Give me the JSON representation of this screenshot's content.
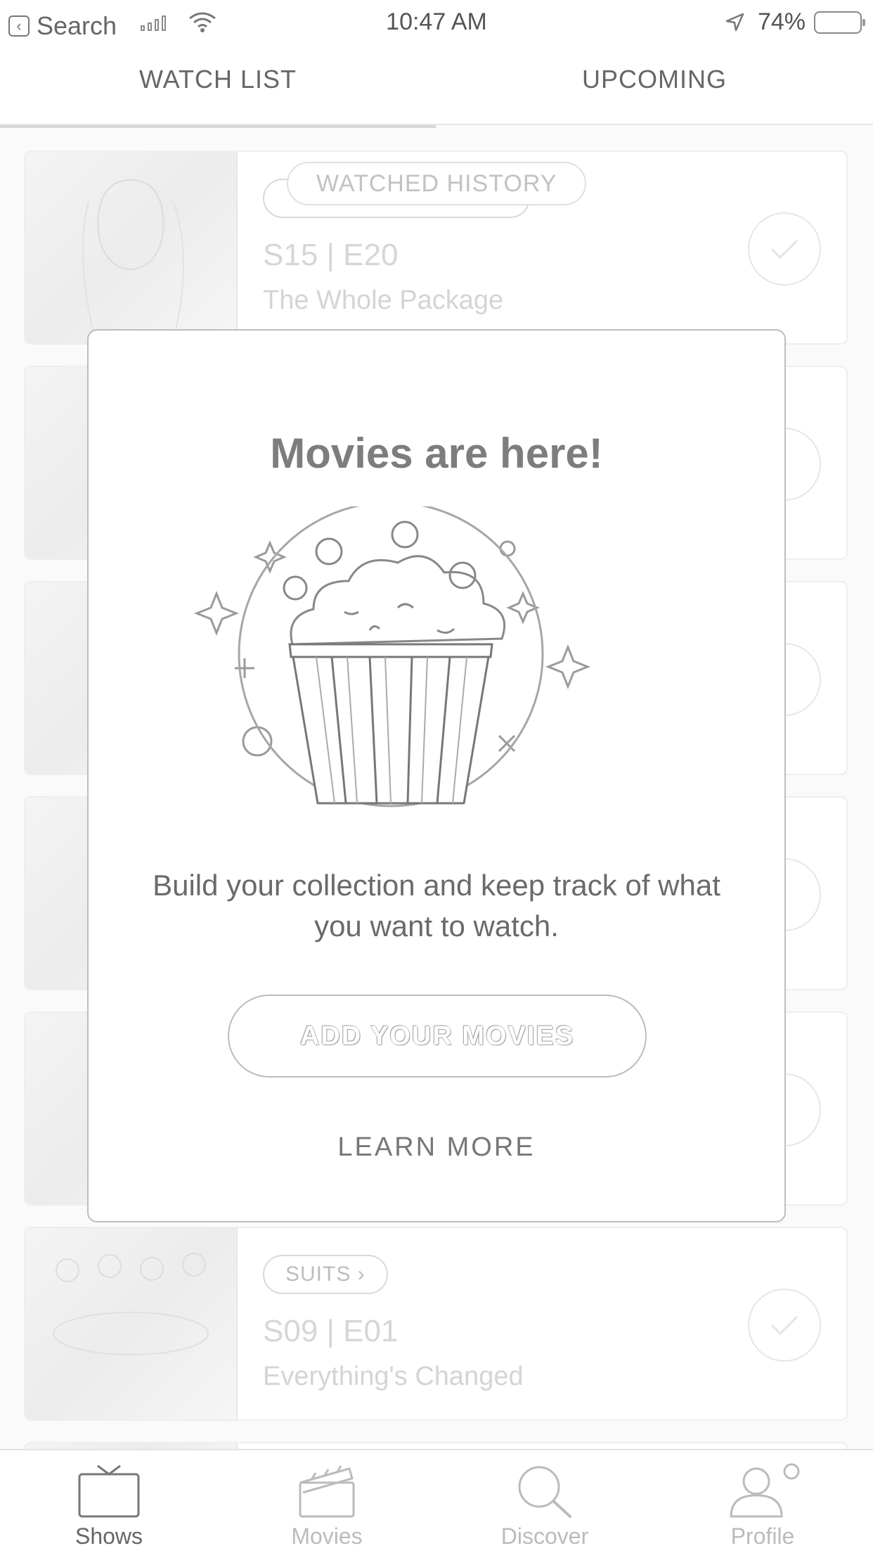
{
  "status_bar": {
    "back_label": "Search",
    "time": "10:47 AM",
    "battery": "74%"
  },
  "tabs": [
    {
      "label": "WATCH LIST",
      "active": true
    },
    {
      "label": "UPCOMING",
      "active": false
    }
  ],
  "history_pill": "WATCHED HISTORY",
  "cards": [
    {
      "episode": "S15 | E20",
      "title": "The Whole Package"
    },
    {
      "show": "SUITS ›",
      "episode": "S09 | E01",
      "title": "Everything's Changed"
    }
  ],
  "modal": {
    "title": "Movies are here!",
    "description": "Build your collection and keep track of what you want to watch.",
    "primary_button": "ADD YOUR MOVIES",
    "secondary_link": "LEARN MORE",
    "illustration": "popcorn-bucket-icon"
  },
  "bottom_nav": [
    {
      "label": "Shows",
      "icon": "tv-icon",
      "active": true
    },
    {
      "label": "Movies",
      "icon": "clapperboard-icon",
      "active": false
    },
    {
      "label": "Discover",
      "icon": "search-icon",
      "active": false
    },
    {
      "label": "Profile",
      "icon": "profile-icon",
      "active": false
    }
  ],
  "colors": {
    "background": "#fafafa",
    "card_border": "#eeeeee",
    "modal_border": "#bdbdbd",
    "text_muted": "#d4d4d4"
  }
}
